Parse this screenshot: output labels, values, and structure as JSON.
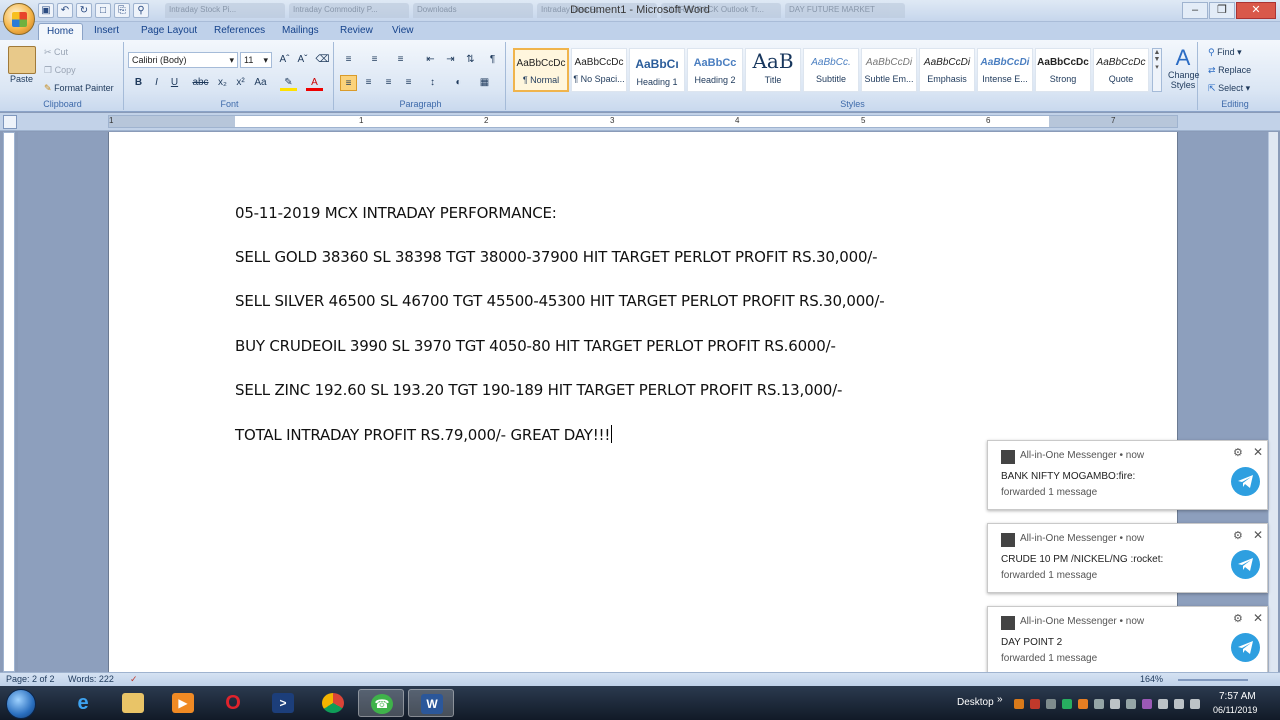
{
  "window": {
    "title": "Document1 - Microsoft Word"
  },
  "browser_tabs": [
    "Intraday Stock Pi...",
    "Intraday Commodity P...",
    "Downloads",
    "Intraday Idea Fr...",
    "ULTRACRACK Outlook Tr...",
    "DAY FUTURE MARKET"
  ],
  "ribbon": {
    "tabs": [
      "Home",
      "Insert",
      "Page Layout",
      "References",
      "Mailings",
      "Review",
      "View"
    ],
    "clipboard": {
      "paste": "Paste",
      "cut": "Cut",
      "copy": "Copy",
      "format_painter": "Format Painter",
      "label": "Clipboard"
    },
    "font": {
      "name": "Calibri (Body)",
      "size": "11",
      "label": "Font"
    },
    "paragraph": {
      "label": "Paragraph"
    },
    "styles": {
      "label": "Styles",
      "items": [
        {
          "sample": "AaBbCcDc",
          "name": "¶ Normal"
        },
        {
          "sample": "AaBbCcDc",
          "name": "¶ No Spaci..."
        },
        {
          "sample": "AaBbCı",
          "name": "Heading 1"
        },
        {
          "sample": "AaBbCc",
          "name": "Heading 2"
        },
        {
          "sample": "AaB",
          "name": "Title"
        },
        {
          "sample": "AaBbCc.",
          "name": "Subtitle"
        },
        {
          "sample": "AaBbCcDi",
          "name": "Subtle Em..."
        },
        {
          "sample": "AaBbCcDi",
          "name": "Emphasis"
        },
        {
          "sample": "AaBbCcDi",
          "name": "Intense E..."
        },
        {
          "sample": "AaBbCcDc",
          "name": "Strong"
        },
        {
          "sample": "AaBbCcDc",
          "name": "Quote"
        }
      ],
      "change_styles": "Change Styles"
    },
    "editing": {
      "find": "Find",
      "replace": "Replace",
      "select": "Select",
      "label": "Editing"
    }
  },
  "ruler_numbers": [
    "1",
    "1",
    "2",
    "3",
    "4",
    "5",
    "6",
    "7"
  ],
  "document": {
    "lines": [
      "05-11-2019 MCX INTRADAY PERFORMANCE:",
      "SELL GOLD 38360 SL 38398 TGT 38000-37900 HIT TARGET PERLOT PROFIT RS.30,000/-",
      "SELL SILVER 46500 SL 46700 TGT 45500-45300 HIT TARGET PERLOT PROFIT RS.30,000/-",
      "BUY CRUDEOIL 3990 SL 3970 TGT 4050-80 HIT TARGET PERLOT PROFIT RS.6000/-",
      "SELL ZINC 192.60 SL 193.20 TGT 190-189 HIT TARGET PERLOT PROFIT RS.13,000/-",
      "TOTAL INTRADAY PROFIT RS.79,000/- GREAT DAY!!!"
    ]
  },
  "notifications": [
    {
      "app": "All-in-One Messenger",
      "time": "now",
      "message": "BANK NIFTY MOGAMBO:fire:",
      "sub": "forwarded 1 message"
    },
    {
      "app": "All-in-One Messenger",
      "time": "now",
      "message": "CRUDE 10 PM /NICKEL/NG :rocket:",
      "sub": "forwarded 1 message"
    },
    {
      "app": "All-in-One Messenger",
      "time": "now",
      "message": "DAY POINT 2",
      "sub": "forwarded 1 message"
    }
  ],
  "statusbar": {
    "page": "Page: 2 of 2",
    "words": "Words: 222",
    "zoom": "164%"
  },
  "taskbar": {
    "desktop": "Desktop",
    "time": "7:57 AM",
    "date": "06/11/2019"
  },
  "colors": {
    "word_blue": "#2b579a",
    "telegram": "#2e9fe0",
    "accent": "#f0b44c"
  }
}
